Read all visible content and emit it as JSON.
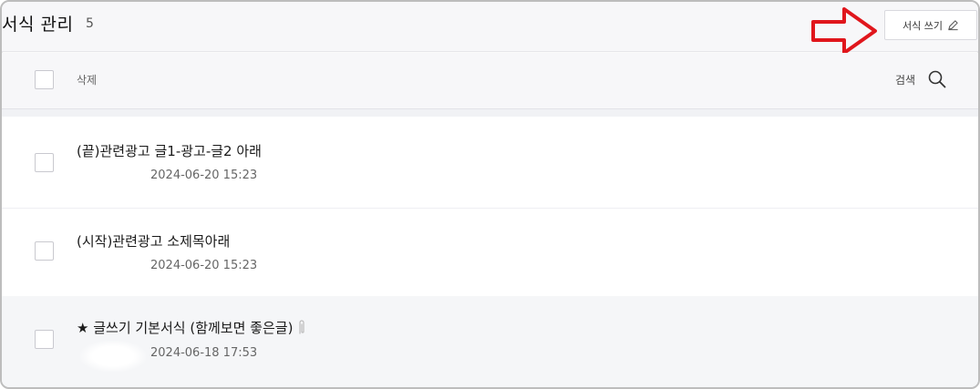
{
  "header": {
    "title": "서식 관리",
    "count": "5",
    "write_button_label": "서식 쓰기",
    "arrow_color": "#e0161c"
  },
  "toolbar": {
    "delete_label": "삭제",
    "search_label": "검색"
  },
  "rows": [
    {
      "title": "(끝)관련광고 글1-광고-글2 아래",
      "date": "2024-06-20 15:23"
    },
    {
      "title": "(시작)관련광고 소제목아래",
      "date": "2024-06-20 15:23"
    },
    {
      "title": "★ 글쓰기 기본서식 (함께보면 좋은글)",
      "date": "2024-06-18 17:53"
    }
  ]
}
